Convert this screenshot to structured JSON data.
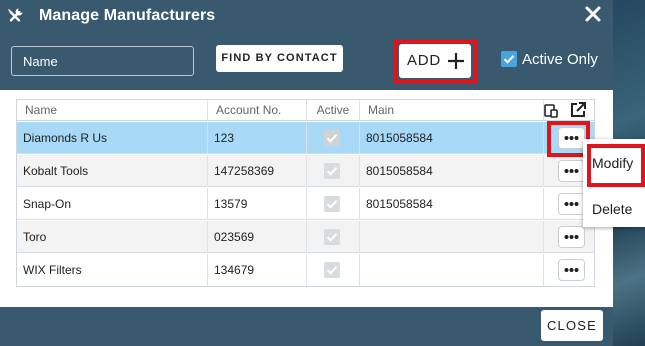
{
  "dialog": {
    "title": "Manage Manufacturers",
    "title_icon": "tools-icon",
    "close_icon": "close-icon"
  },
  "toolbar": {
    "name_placeholder": "Name",
    "find_by_contact_label": "FIND BY CONTACT",
    "add_label": "ADD",
    "add_icon": "plus-icon",
    "active_only_label": "Active Only",
    "active_only_checked": true
  },
  "table": {
    "columns": [
      "Name",
      "Account No.",
      "Active",
      "Main"
    ],
    "header_icons": [
      "mobile-device-icon",
      "external-link-icon"
    ],
    "rows": [
      {
        "name": "Diamonds R Us",
        "account": "123",
        "active": true,
        "main": "8015058584",
        "selected": true
      },
      {
        "name": "Kobalt Tools",
        "account": "147258369",
        "active": true,
        "main": "8015058584",
        "selected": false
      },
      {
        "name": "Snap-On",
        "account": "13579",
        "active": true,
        "main": "8015058584",
        "selected": false
      },
      {
        "name": "Toro",
        "account": "023569",
        "active": true,
        "main": "",
        "selected": false
      },
      {
        "name": "WIX Filters",
        "account": "134679",
        "active": true,
        "main": "",
        "selected": false
      }
    ],
    "row_action_icon": "more-icon"
  },
  "context_menu": {
    "items": [
      "Modify",
      "Delete"
    ]
  },
  "footer": {
    "close_label": "CLOSE"
  },
  "colors": {
    "header_bg": "#38596e",
    "selected_row": "#a8d9f7",
    "highlight": "#e0141c",
    "checkbox_accent": "#4aa3df"
  }
}
